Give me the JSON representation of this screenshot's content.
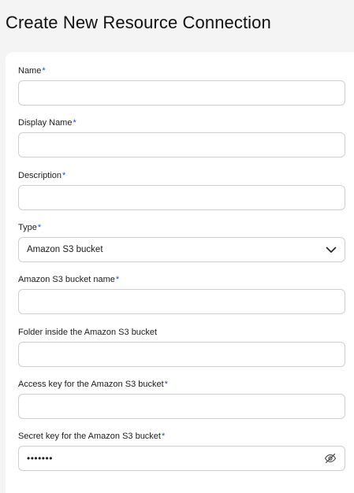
{
  "page": {
    "title": "Create New Resource Connection"
  },
  "form": {
    "required_marker": "*",
    "name": {
      "label": "Name",
      "value": "",
      "placeholder": ""
    },
    "display_name": {
      "label": "Display Name",
      "value": "",
      "placeholder": ""
    },
    "description": {
      "label": "Description",
      "value": "",
      "placeholder": ""
    },
    "type": {
      "label": "Type",
      "selected": "Amazon S3 bucket"
    },
    "bucket_name": {
      "label": "Amazon S3 bucket name",
      "value": "",
      "placeholder": ""
    },
    "folder": {
      "label": "Folder inside the Amazon S3 bucket",
      "value": "",
      "placeholder": ""
    },
    "access_key": {
      "label": "Access key for the Amazon S3 bucket",
      "value": "",
      "placeholder": ""
    },
    "secret_key": {
      "label": "Secret key for the Amazon S3 bucket",
      "masked_value": "•••••••"
    }
  },
  "icons": {
    "type_dropdown": "chevron-down-icon",
    "secret_visibility": "eye-off-icon"
  },
  "colors": {
    "required_marker": "#1b4fd8",
    "input_border": "#cfcfcf",
    "page_background": "#f4f4f4",
    "card_background": "#ffffff"
  }
}
